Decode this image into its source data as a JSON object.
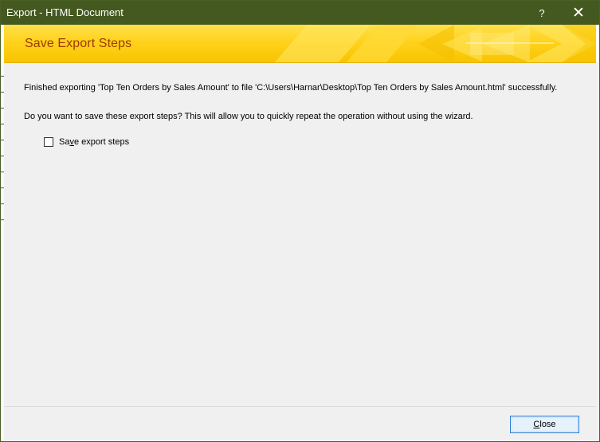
{
  "window": {
    "title": "Export - HTML Document",
    "help_label": "?",
    "close_glyph": "✕"
  },
  "banner": {
    "title": "Save Export Steps"
  },
  "content": {
    "message_success": "Finished exporting 'Top Ten Orders by Sales Amount' to file 'C:\\Users\\Harnar\\Desktop\\Top Ten Orders by Sales Amount.html' successfully.",
    "message_question": "Do you want to save these export steps? This will allow you to quickly repeat the operation without using the wizard.",
    "checkbox": {
      "label_prefix": "Sa",
      "label_mnemonic": "v",
      "label_suffix": "e export steps",
      "checked": false
    }
  },
  "footer": {
    "close_mnemonic": "C",
    "close_suffix": "lose"
  },
  "colors": {
    "titlebar": "#44591f",
    "banner_yellow": "#ffd21c",
    "banner_text": "#9b3a00",
    "button_border": "#2a7ad5"
  }
}
